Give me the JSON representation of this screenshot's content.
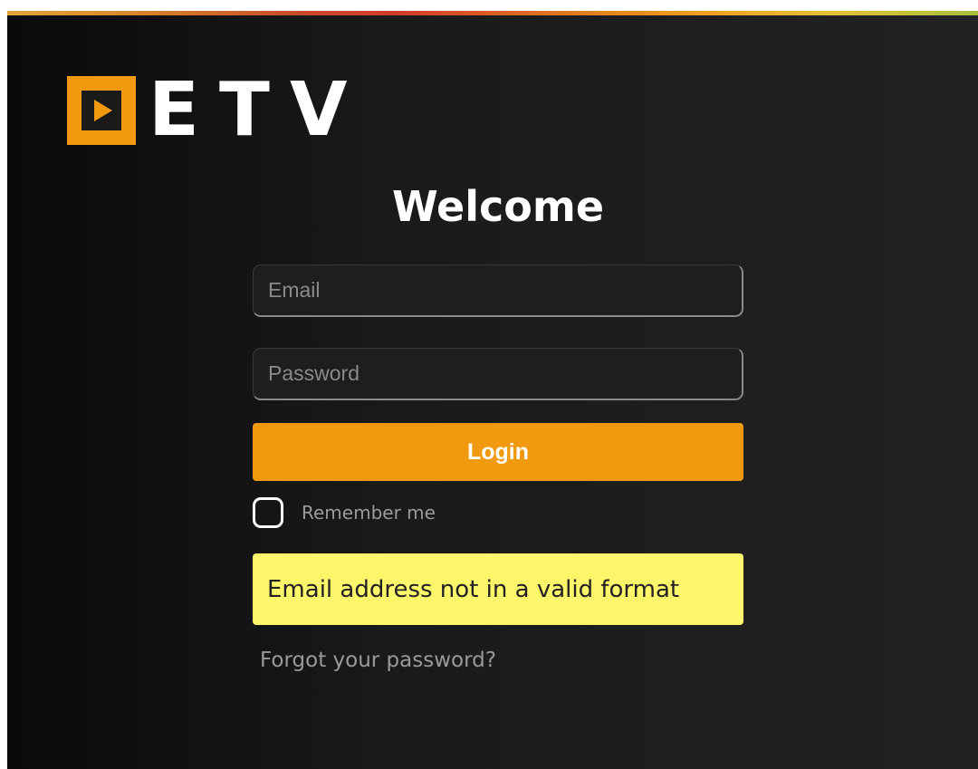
{
  "brand": {
    "name": "ETV",
    "colors": {
      "accent": "#f29a0f",
      "logo_mark": "#f29a0f",
      "alert_bg": "#fdf66a"
    }
  },
  "heading": "Welcome",
  "form": {
    "email_placeholder": "Email",
    "email_value": "",
    "password_placeholder": "Password",
    "password_value": "",
    "login_label": "Login",
    "remember_label": "Remember me",
    "remember_checked": false
  },
  "alert": {
    "message": "Email address not in a valid format"
  },
  "forgot_link": "Forgot your password?"
}
